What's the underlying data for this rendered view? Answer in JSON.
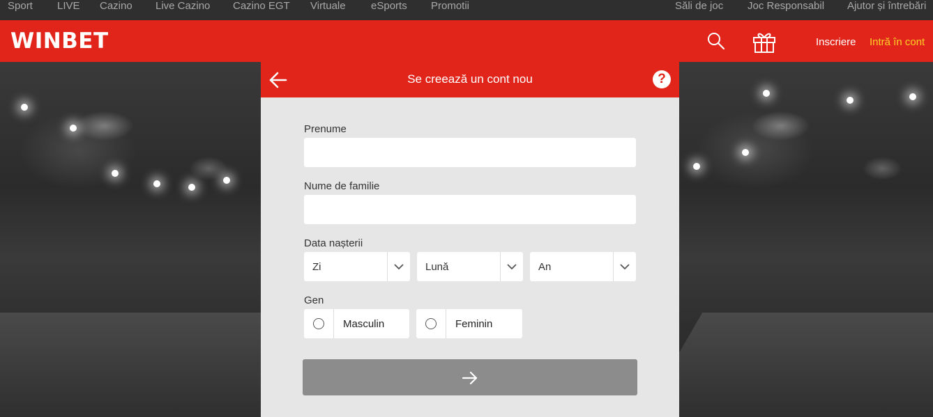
{
  "topnav": {
    "items": [
      "Sport",
      "LIVE",
      "Cazino",
      "Live Cazino",
      "Cazino EGT",
      "Virtuale",
      "eSports",
      "Promotii",
      "Săli de joc",
      "Joc Responsabil",
      "Ajutor și întrebări"
    ]
  },
  "header": {
    "logo": "WINBET",
    "search_icon": "search-icon",
    "gift_icon": "gift-icon",
    "signup": "Inscriere",
    "login": "Intră în cont",
    "accent": "#e1251b",
    "login_color": "#ffd026"
  },
  "modal": {
    "title": "Se creează un cont nou",
    "back_icon": "arrow-left-icon",
    "help": "?",
    "first_name": {
      "label": "Prenume",
      "value": "",
      "placeholder": ""
    },
    "last_name": {
      "label": "Nume de familie",
      "value": "",
      "placeholder": ""
    },
    "birth": {
      "label": "Data nașterii",
      "day": "Zi",
      "month": "Lună",
      "year": "An"
    },
    "gender": {
      "label": "Gen",
      "male": "Masculin",
      "female": "Feminin"
    },
    "submit_icon": "arrow-right-icon",
    "submit_color": "#8c8c8c"
  }
}
